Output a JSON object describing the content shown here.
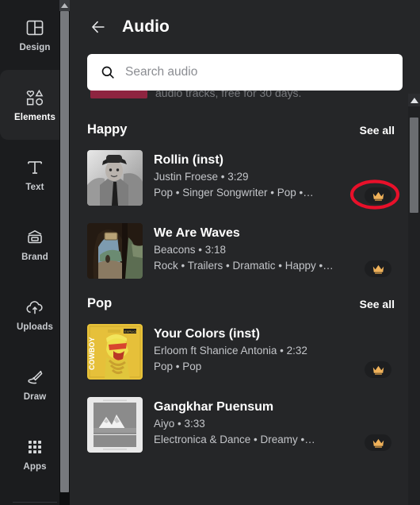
{
  "sidebar": {
    "items": [
      {
        "label": "Design",
        "icon": "layout-panels-icon",
        "active": false
      },
      {
        "label": "Elements",
        "icon": "shapes-icon",
        "active": true
      },
      {
        "label": "Text",
        "icon": "text-t-icon",
        "active": false
      },
      {
        "label": "Brand",
        "icon": "brand-card-icon",
        "active": false
      },
      {
        "label": "Uploads",
        "icon": "cloud-upload-icon",
        "active": false
      },
      {
        "label": "Draw",
        "icon": "pen-draw-icon",
        "active": false
      },
      {
        "label": "Apps",
        "icon": "grid-apps-icon",
        "active": false
      }
    ]
  },
  "header": {
    "back_icon": "arrow-left-icon",
    "title": "Audio"
  },
  "search": {
    "icon": "search-icon",
    "placeholder": "Search audio",
    "value": ""
  },
  "ghost_banner": {
    "text": "audio tracks, free for 30 days."
  },
  "sections": [
    {
      "title": "Happy",
      "see_all": "See all",
      "tracks": [
        {
          "title": "Rollin (inst)",
          "meta": "Justin Froese • 3:29",
          "tags": "Pop • Singer Songwriter • Pop •…",
          "badge": "crown-icon",
          "artwork": "portrait-man-hat-bw",
          "highlighted": true
        },
        {
          "title": "We Are Waves",
          "meta": "Beacons • 3:18",
          "tags": "Rock • Trailers • Dramatic • Happy •…",
          "badge": "crown-icon",
          "artwork": "tunnel-landscape",
          "highlighted": false
        }
      ]
    },
    {
      "title": "Pop",
      "see_all": "See all",
      "tracks": [
        {
          "title": "Your Colors (inst)",
          "meta": "Erloom ft Shanice Antonia • 2:32",
          "tags": "Pop • Pop",
          "badge": "crown-icon",
          "artwork": "cowboy-yellow-cover",
          "highlighted": false
        },
        {
          "title": "Gangkhar Puensum",
          "meta": "Aiyo • 3:33",
          "tags": "Electronica & Dance • Dreamy •…",
          "badge": "crown-icon",
          "artwork": "mountains-grey-cover",
          "highlighted": false
        }
      ]
    }
  ],
  "annotation": {
    "shape": "red-ellipse-highlight",
    "color": "#e8102a",
    "target": "crown-badge-rollin"
  },
  "scrollbars": {
    "left": {
      "arrow_icon": "triangle-up-icon"
    },
    "right": {
      "arrow_icon": "triangle-up-icon"
    }
  },
  "colors": {
    "panel_bg": "#252628",
    "rail_bg": "#1b1c1e",
    "accent_crown": "#f0b25a",
    "annotation_red": "#e8102a"
  }
}
